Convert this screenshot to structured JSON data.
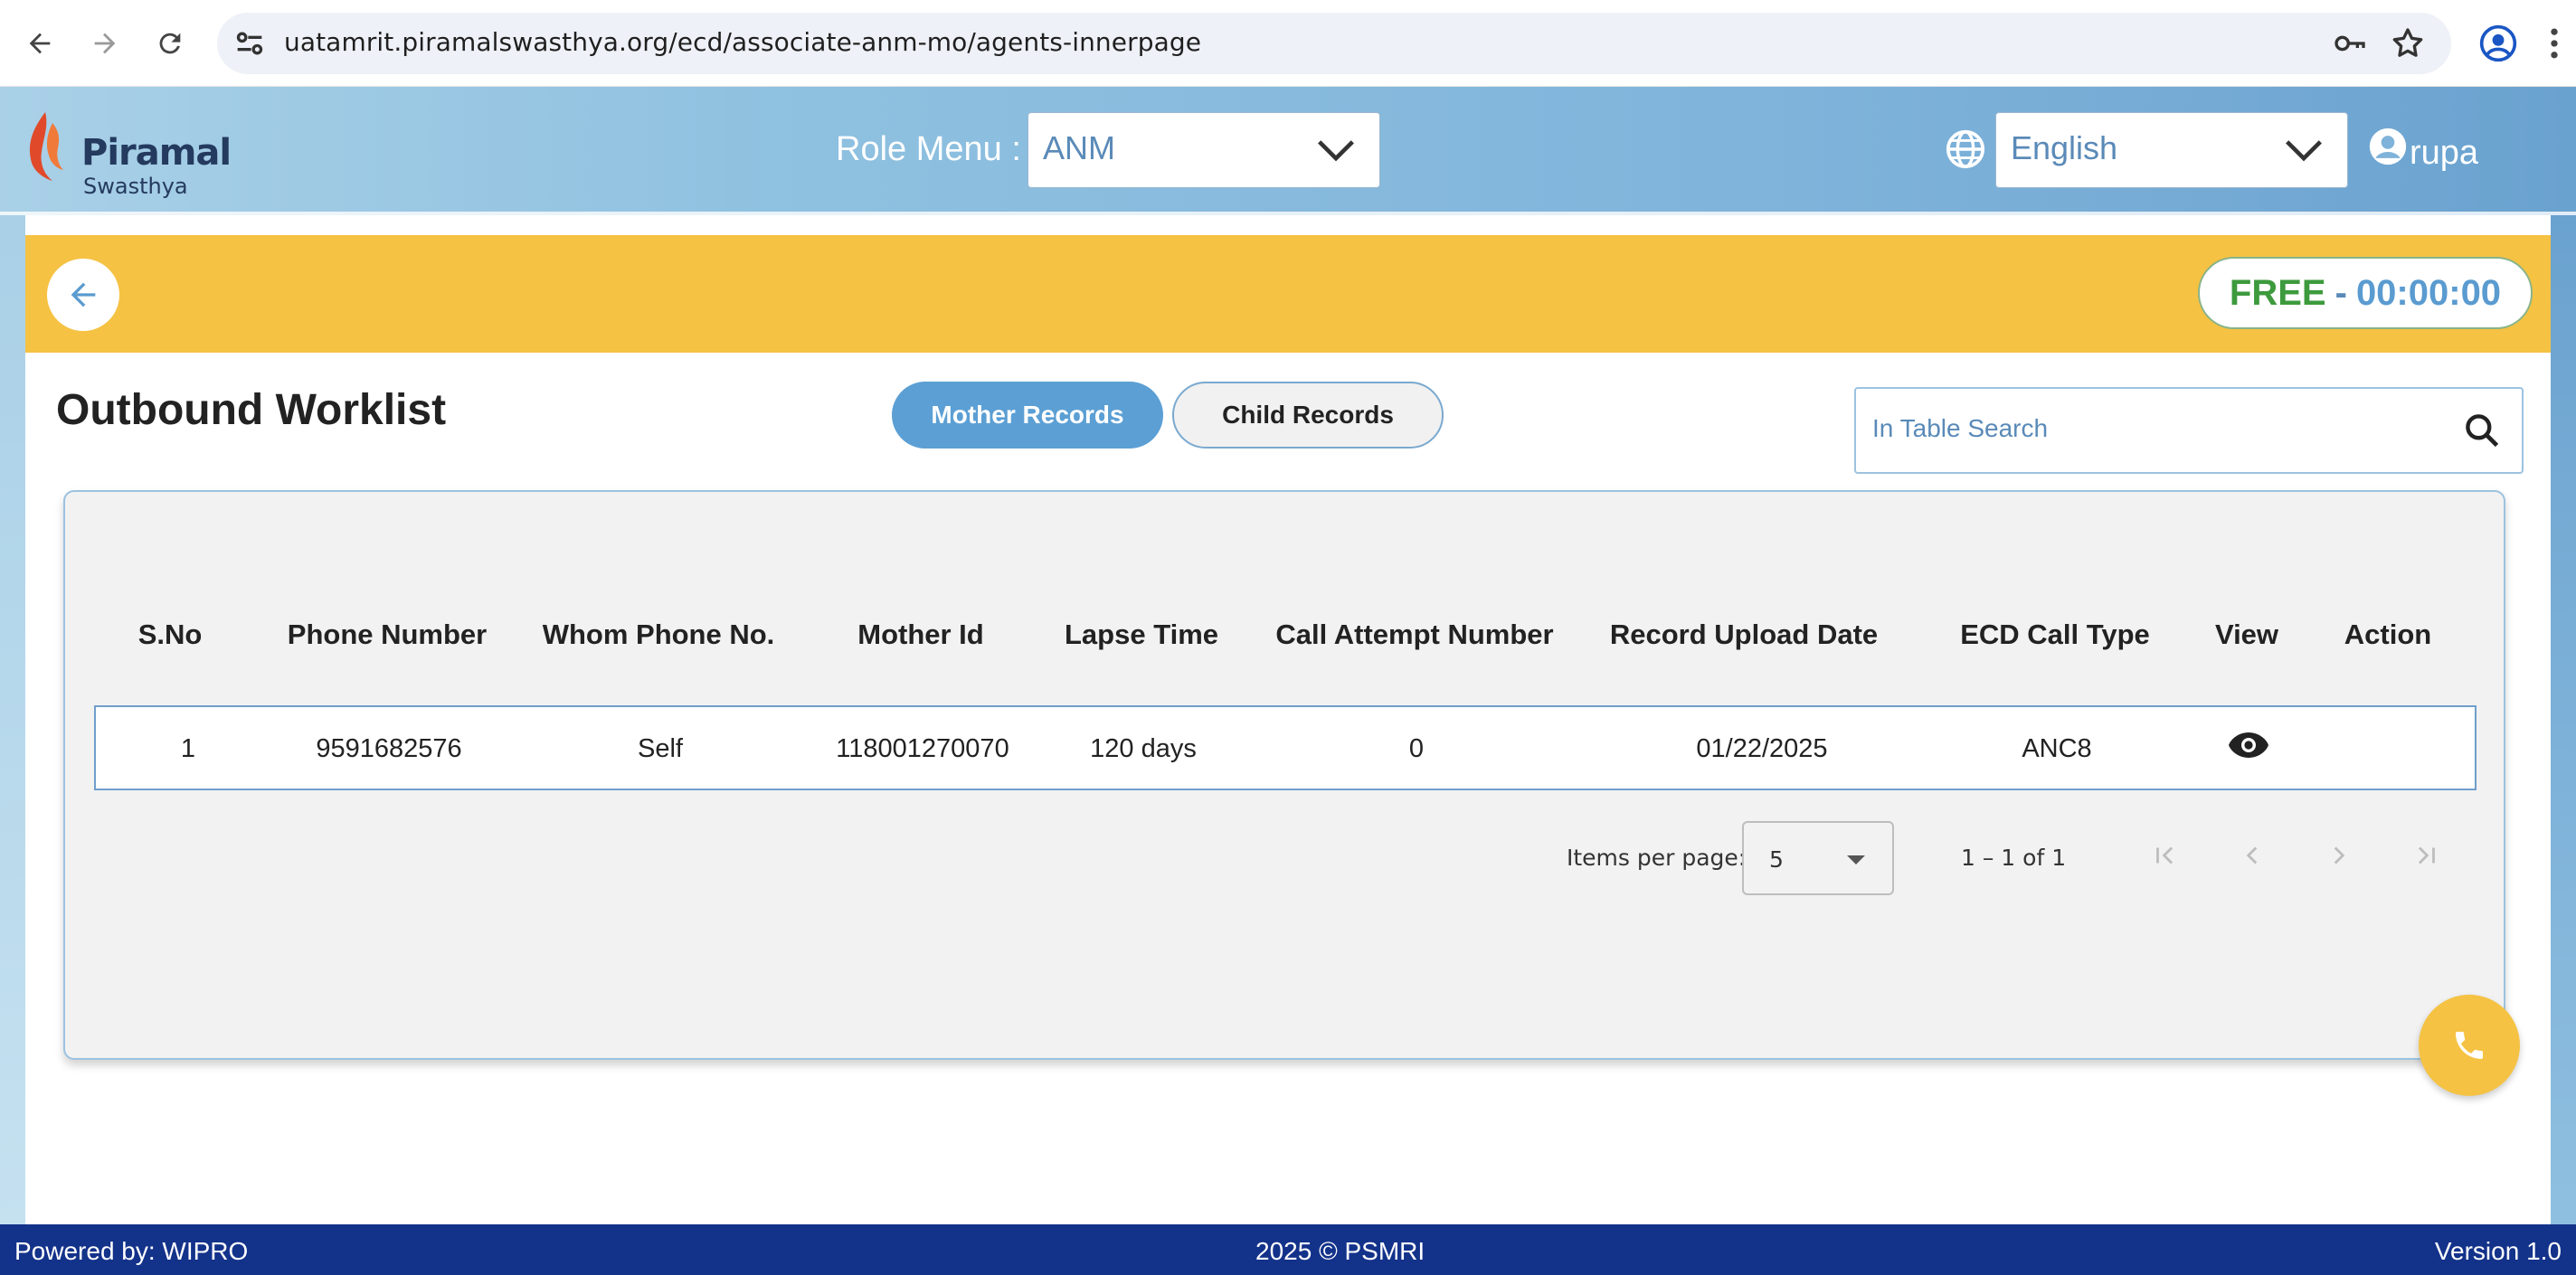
{
  "browser": {
    "url": "uatamrit.piramalswasthya.org/ecd/associate-anm-mo/agents-innerpage",
    "icons": [
      "back-arrow-icon",
      "forward-arrow-icon",
      "reload-icon",
      "site-info-icon",
      "key-icon",
      "star-icon",
      "profile-icon",
      "menu-dots-icon"
    ]
  },
  "header": {
    "logo_text": "Piramal",
    "logo_sub": "Swasthya",
    "role_label": "Role Menu :",
    "role_value": "ANM",
    "language_value": "English",
    "user_name": "rupa"
  },
  "banner": {
    "status": "FREE",
    "separator": "-",
    "timer": "00:00:00",
    "colors": {
      "banner": "#f5c243",
      "status": "#3d9a3d",
      "timer": "#5a9bd0"
    }
  },
  "main": {
    "title": "Outbound Worklist",
    "tabs": [
      {
        "label": "Mother Records",
        "active": true
      },
      {
        "label": "Child Records",
        "active": false
      }
    ],
    "search_placeholder": "In Table Search"
  },
  "table": {
    "columns": [
      "S.No",
      "Phone Number",
      "Whom Phone No.",
      "Mother Id",
      "Lapse Time",
      "Call Attempt Number",
      "Record Upload Date",
      "ECD Call Type",
      "View",
      "Action"
    ],
    "rows": [
      {
        "sno": "1",
        "phone": "9591682576",
        "whom": "Self",
        "mother_id": "118001270070",
        "lapse": "120 days",
        "attempt": "0",
        "upload_date": "01/22/2025",
        "call_type": "ANC8",
        "view_icon": "eye-icon",
        "action": ""
      }
    ]
  },
  "pager": {
    "items_label": "Items per page:",
    "items_value": "5",
    "range": "1 – 1 of 1"
  },
  "footer": {
    "left": "Powered by: WIPRO",
    "center": "2025 © PSMRI",
    "right": "Version 1.0",
    "color": "#13328a"
  }
}
